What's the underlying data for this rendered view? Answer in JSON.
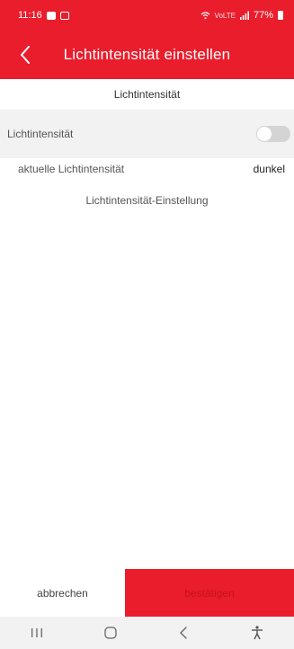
{
  "status_bar": {
    "time": "11:16",
    "network": "VoLTE",
    "battery": "77%"
  },
  "header": {
    "title": "Lichtintensität einstellen",
    "back_icon": "chevron-left-icon"
  },
  "section": {
    "title": "Lichtintensität"
  },
  "toggle_row": {
    "label": "Lichtintensität",
    "enabled": false
  },
  "current": {
    "label": "aktuelle Lichtintensität",
    "value": "dunkel"
  },
  "setting": {
    "title": "Lichtintensität-Einstellung"
  },
  "buttons": {
    "cancel": "abbrechen",
    "confirm": "bestätigen"
  },
  "colors": {
    "accent": "#ea1d2c",
    "background": "#f2f2f2"
  }
}
